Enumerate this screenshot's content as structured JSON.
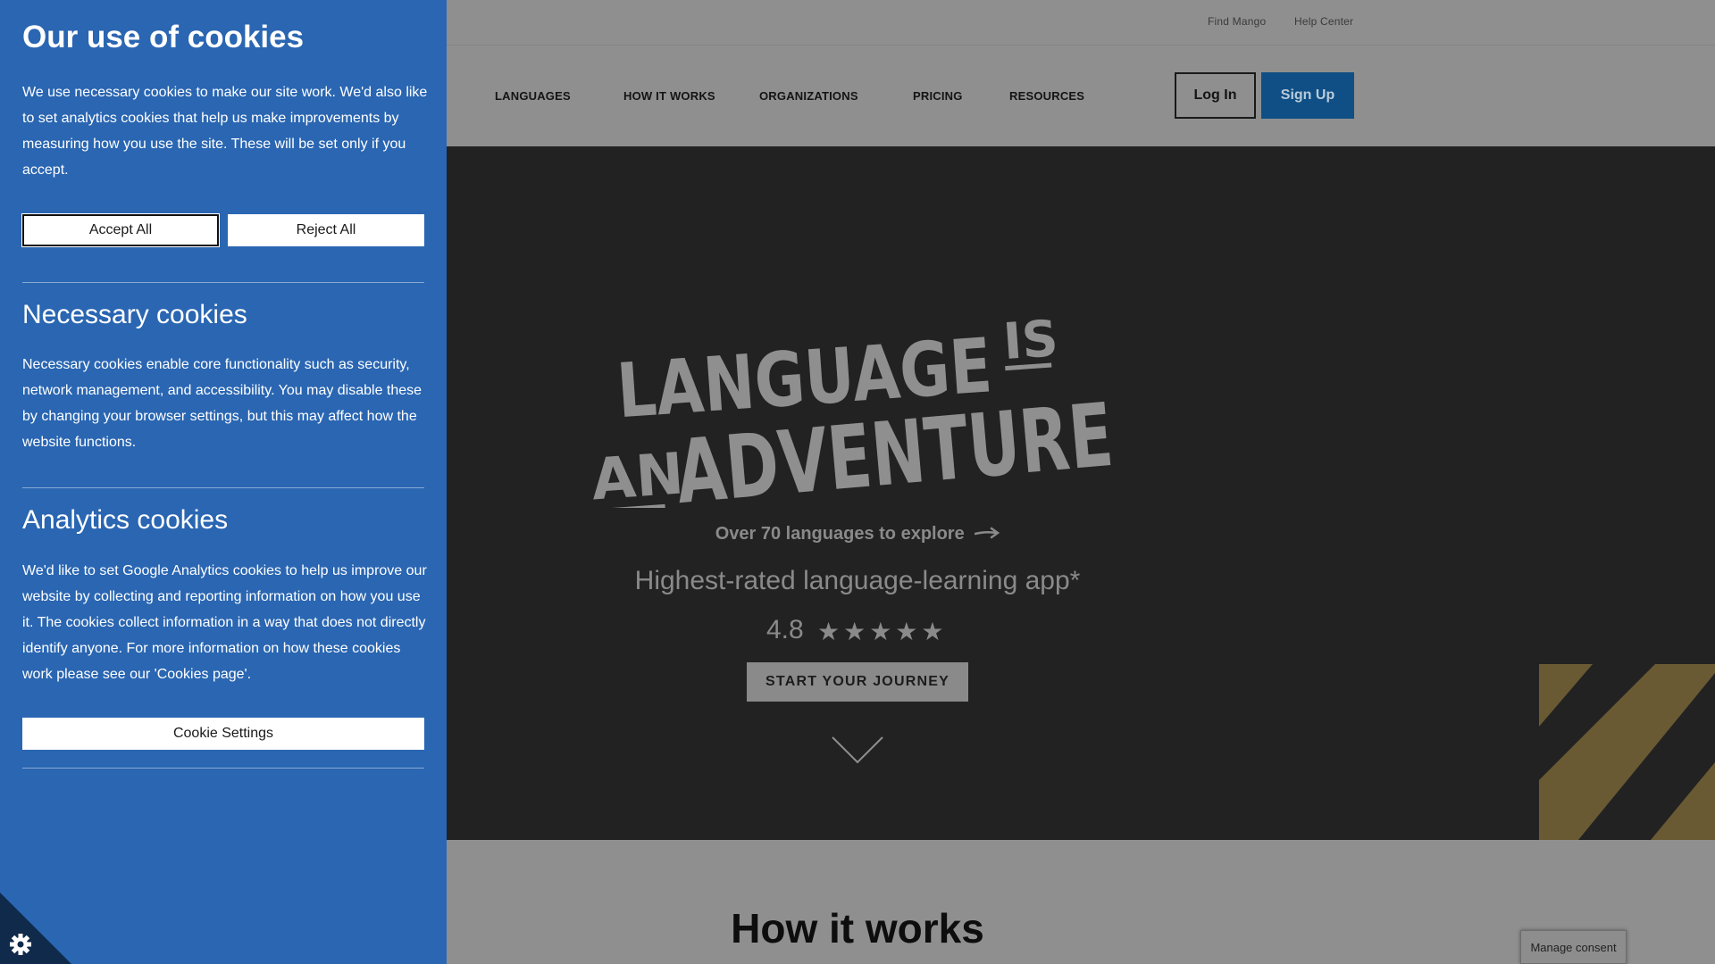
{
  "topbar": {
    "links": [
      {
        "label": "Find Mango"
      },
      {
        "label": "Help Center"
      }
    ]
  },
  "nav": {
    "items": [
      {
        "label": "LANGUAGES"
      },
      {
        "label": "HOW IT WORKS"
      },
      {
        "label": "ORGANIZATIONS"
      },
      {
        "label": "PRICING"
      },
      {
        "label": "RESOURCES"
      }
    ],
    "login_label": "Log In",
    "signup_label": "Sign Up"
  },
  "hero": {
    "logo_text": [
      "LANGUAGE",
      "IS",
      "AN",
      "ADVENTURE"
    ],
    "explore_link": "Over 70 languages to explore",
    "tagline": "Highest-rated language-learning app*",
    "rating": "4.8",
    "stars": "★★★★★",
    "cta_label": "START YOUR JOURNEY"
  },
  "section": {
    "title": "How it works"
  },
  "manage_consent_label": "Manage consent",
  "cookie_panel": {
    "title": "Our use of cookies",
    "intro": "We use necessary cookies to make our site work. We'd also like to set analytics cookies that help us make improvements by measuring how you use the site. These will be set only if you accept.",
    "accept_label": "Accept All",
    "reject_label": "Reject All",
    "necessary_title": "Necessary cookies",
    "necessary_text": "Necessary cookies enable core functionality such as security, network management, and accessibility. You may disable these by changing your browser settings, but this may affect how the website functions.",
    "analytics_title": "Analytics cookies",
    "analytics_text": "We'd like to set Google Analytics cookies to help us improve our website by collecting and reporting information on how you use it. The cookies collect information in a way that does not directly identify anyone. For more information on how these cookies work please see our 'Cookies page'.",
    "settings_label": "Cookie Settings"
  },
  "icons": {
    "corner": "gear-icon",
    "explore_arrow": "arrow-right-icon",
    "scroll": "chevron-down-icon"
  },
  "colors": {
    "panel_bg": "#2a66b2",
    "signup_bg": "#0f4f85",
    "hero_bg": "#222222",
    "page_overlay": "#8f8f8f",
    "accent_stripe": "#6a5a33"
  }
}
